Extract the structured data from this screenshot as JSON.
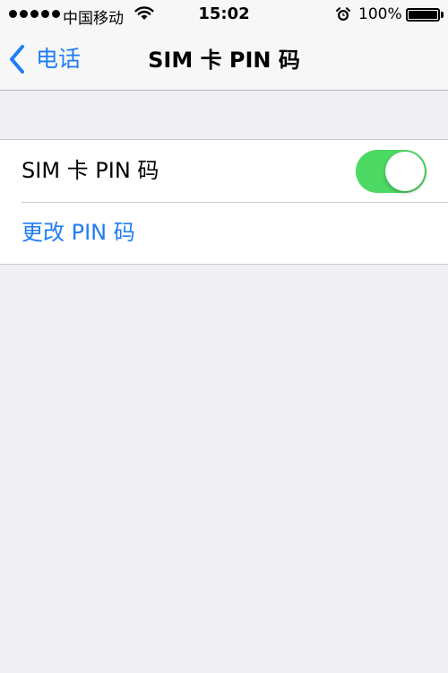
{
  "status_bar": {
    "carrier": "中国移动",
    "time": "15:02",
    "battery": "100%",
    "signal_bars": 5
  },
  "nav": {
    "back_label": "电话",
    "title": "SIM 卡 PIN 码"
  },
  "settings": {
    "sim_pin_label": "SIM 卡 PIN 码",
    "sim_pin_enabled": true,
    "change_pin_label": "更改 PIN 码"
  },
  "colors": {
    "accent": "#1f7cf5",
    "toggle_on": "#4cd964",
    "background": "#efeff4"
  }
}
